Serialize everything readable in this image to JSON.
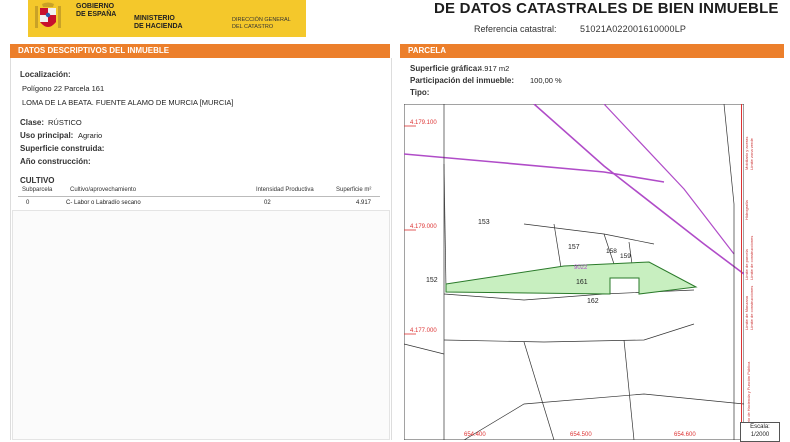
{
  "header": {
    "gobierno_line1": "GOBIERNO",
    "gobierno_line2": "DE ESPAÑA",
    "ministerio_line1": "MINISTERIO",
    "ministerio_line2": "DE HACIENDA",
    "direccion_line1": "DIRECCIÓN GENERAL",
    "direccion_line2": "DEL CATASTRO",
    "title": "DE DATOS CATASTRALES DE BIEN INMUEBLE",
    "ref_label": "Referencia catastral:",
    "ref_value": "51021A022001610000LP",
    "brand_yellow": "#f4c82b",
    "accent_orange": "#ec7f2b"
  },
  "left": {
    "section_title": "DATOS DESCRIPTIVOS DEL INMUEBLE",
    "localizacion_label": "Localización:",
    "localizacion_line1": "Polígono 22 Parcela 161",
    "localizacion_line2": "LOMA DE LA BEATA. FUENTE ALAMO DE MURCIA [MURCIA]",
    "clase_label": "Clase:",
    "clase_value": "RÚSTICO",
    "uso_label": "Uso principal:",
    "uso_value": "Agrario",
    "superficie_label": "Superficie construida:",
    "ano_label": "Año construcción:",
    "cultivo_title": "CULTIVO",
    "table": {
      "headers": [
        "Subparcela",
        "Cultivo/aprovechamiento",
        "Intensidad Productiva",
        "Superficie m²"
      ],
      "rows": [
        [
          "0",
          "C- Labor o Labradío secano",
          "02",
          "4.917"
        ]
      ]
    }
  },
  "right": {
    "section_title": "PARCELA",
    "sup_label": "Superficie gráfica:",
    "sup_value": "4.917 m2",
    "part_label": "Participación del inmueble:",
    "part_value": "100,00 %",
    "tipo_label": "Tipo:",
    "map": {
      "y_ticks": [
        "4.179.100",
        "4.179.000",
        "4.177.000"
      ],
      "x_ticks": [
        "654.400",
        "654.500",
        "654.600"
      ],
      "parcels": [
        "153",
        "157",
        "158",
        "159",
        "152",
        "9022",
        "161",
        "162"
      ],
      "legend": [
        "Límite de parcela",
        "Límite de construcciones",
        "Mobiliario y aceras",
        "Límite zona verde",
        "Hidrografía",
        "Límite de Manzana",
        "Límite de construcciones"
      ],
      "edge_note": "Ministerio de Hacienda y Función Pública",
      "scale_label": "Escala:",
      "scale_value": "1/2000"
    }
  }
}
